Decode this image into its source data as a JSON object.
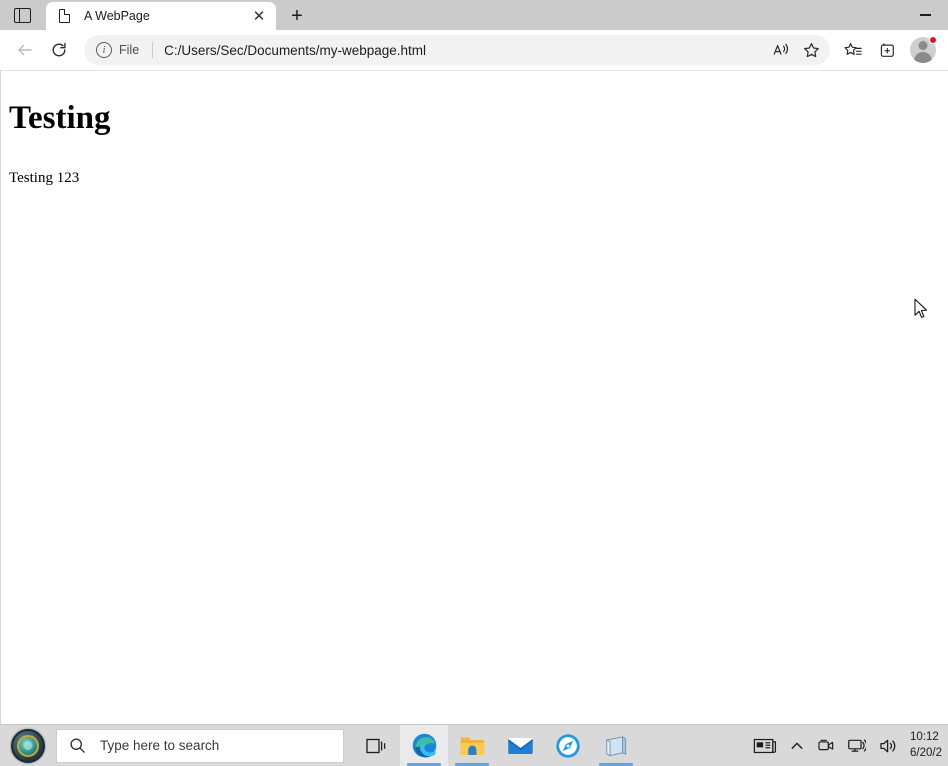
{
  "browser": {
    "tabstrip": {
      "tab_actions_label": "tab-actions",
      "tabs": [
        {
          "title": "A WebPage",
          "favicon": "page-icon",
          "close_label": "✕",
          "active": true
        }
      ],
      "newtab_label": "+",
      "minimize_label": "minimize"
    },
    "toolbar": {
      "back_label": "back",
      "reload_label": "reload",
      "omnibox": {
        "info_glyph": "i",
        "scheme_label": "File",
        "url": "C:/Users/Sec/Documents/my-webpage.html",
        "read_aloud_label": "read-aloud",
        "favorite_label": "add-favorite"
      },
      "favorites_label": "favorites",
      "collections_label": "collections",
      "profile_label": "profile",
      "notification_badge": ""
    },
    "page": {
      "heading": "Testing",
      "paragraph": "Testing 123"
    }
  },
  "taskbar": {
    "start_label": "start",
    "search": {
      "icon": "search-icon",
      "placeholder": "Type here to search"
    },
    "apps": [
      {
        "name": "task-view",
        "running": false,
        "active": false
      },
      {
        "name": "microsoft-edge",
        "running": true,
        "active": true
      },
      {
        "name": "file-explorer",
        "running": true,
        "active": false
      },
      {
        "name": "mail",
        "running": false,
        "active": false
      },
      {
        "name": "compass-app",
        "running": false,
        "active": false
      },
      {
        "name": "notepad",
        "running": true,
        "active": false
      }
    ],
    "tray": {
      "news_label": "news-and-interests",
      "chevron_label": "show-hidden-icons",
      "camera_label": "camera",
      "network_label": "network",
      "volume_label": "volume"
    },
    "clock": {
      "time": "10:12",
      "date": "6/20/2"
    }
  },
  "colors": {
    "tabstrip_bg": "#cbcbcb",
    "toolbar_bg": "#ffffff",
    "taskbar_bg": "#d9d9d9",
    "accent": "#5aa7e8",
    "badge": "#e81123"
  }
}
